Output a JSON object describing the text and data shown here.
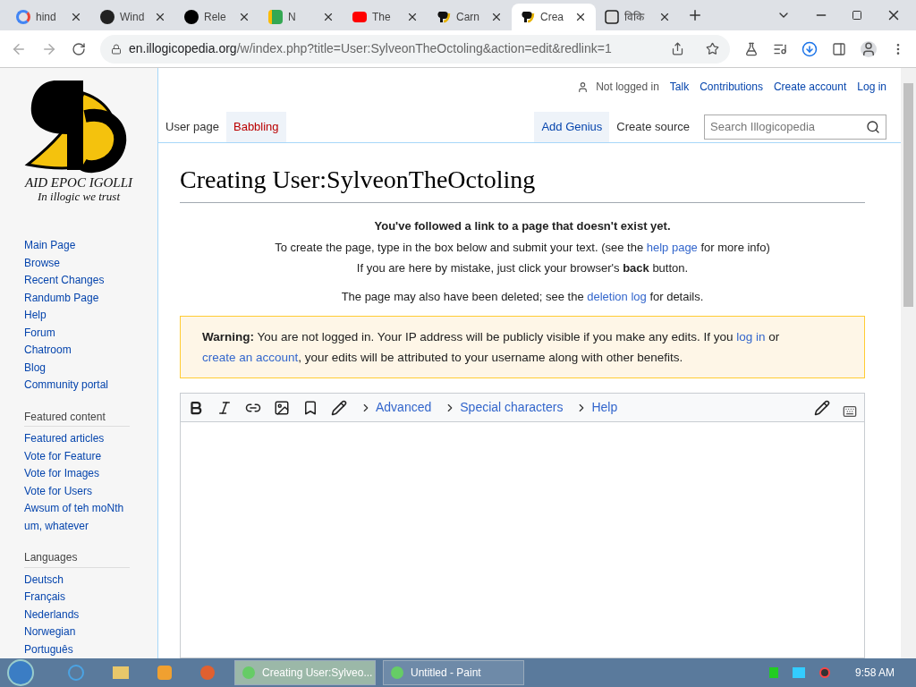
{
  "browser": {
    "tabs": [
      {
        "title": "hind",
        "selected": false
      },
      {
        "title": "Wind",
        "selected": false
      },
      {
        "title": "Rele",
        "selected": false
      },
      {
        "title": "N",
        "selected": false
      },
      {
        "title": "The",
        "selected": false
      },
      {
        "title": "Carn",
        "selected": false
      },
      {
        "title": "Crea",
        "selected": true
      },
      {
        "title": "विकि",
        "selected": false
      }
    ],
    "url_host": "en.illogicopedia.org",
    "url_path": "/w/index.php?title=User:SylveonTheOctoling&action=edit&redlink=1"
  },
  "logo": {
    "title": "AID EPOC IGOLLI",
    "motto": "In illogic we trust"
  },
  "personal": {
    "status": "Not logged in",
    "links": [
      "Talk",
      "Contributions",
      "Create account",
      "Log in"
    ]
  },
  "page_tabs": {
    "left": [
      {
        "label": "User page",
        "selected": true,
        "missing": false
      },
      {
        "label": "Babbling",
        "selected": false,
        "missing": true
      }
    ],
    "right": [
      {
        "label": "Add Genius",
        "selected": false
      },
      {
        "label": "Create source",
        "selected": true
      }
    ],
    "search_placeholder": "Search Illogicopedia"
  },
  "sidebar": {
    "links": [
      "Main Page",
      "Browse",
      "Recent Changes",
      "Randumb Page",
      "Help",
      "Forum",
      "Chatroom",
      "Blog",
      "Community portal"
    ],
    "sections": [
      {
        "heading": "Featured content",
        "links": [
          "Featured articles",
          "Vote for Feature",
          "Vote for Images",
          "Vote for Users",
          "Awsum of teh moNth um, whatever"
        ]
      },
      {
        "heading": "Languages",
        "links": [
          "Deutsch",
          "Français",
          "Nederlands",
          "Norwegian",
          "Português"
        ]
      }
    ]
  },
  "heading": "Creating User:SylveonTheOctoling",
  "notice": [
    [
      {
        "kind": "bold",
        "text": "You've followed a link to a page that doesn't exist yet."
      }
    ],
    [
      {
        "kind": "text",
        "text": "To create the page, type in the box below and submit your text. (see the "
      },
      {
        "kind": "link",
        "text": "help page"
      },
      {
        "kind": "text",
        "text": " for more info)"
      }
    ],
    [
      {
        "kind": "text",
        "text": "If you are here by mistake, just click your browser's "
      },
      {
        "kind": "bold",
        "text": "back"
      },
      {
        "kind": "text",
        "text": " button."
      }
    ],
    [
      {
        "kind": "text",
        "text": "The page may also have been deleted; see the "
      },
      {
        "kind": "link",
        "text": "deletion log"
      },
      {
        "kind": "text",
        "text": " for details."
      }
    ]
  ],
  "warning": [
    {
      "kind": "bold",
      "text": "Warning:"
    },
    {
      "kind": "text",
      "text": " You are not logged in. Your IP address will be publicly visible if you make any edits. If you "
    },
    {
      "kind": "link",
      "text": "log in"
    },
    {
      "kind": "text",
      "text": " or "
    },
    {
      "kind": "link",
      "text": "create an account"
    },
    {
      "kind": "text",
      "text": ", your edits will be attributed to your username along with other benefits."
    }
  ],
  "editor": {
    "groups": [
      "Advanced",
      "Special characters",
      "Help"
    ]
  },
  "taskbar": {
    "windows": [
      {
        "title": "Creating User:Sylveo...",
        "selected": true
      },
      {
        "title": "Untitled - Paint",
        "selected": false
      }
    ],
    "clock": "9:58 AM"
  }
}
